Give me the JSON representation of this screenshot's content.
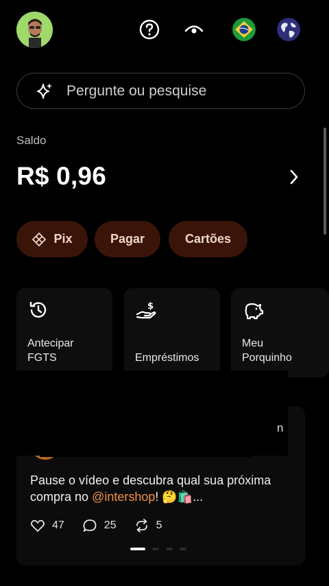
{
  "header": {
    "help_icon": "help-circle-icon",
    "visibility_icon": "eye-icon",
    "country_flag": "brazil-flag-icon",
    "globe_icon": "globe-icon"
  },
  "search": {
    "placeholder": "Pergunte ou pesquise",
    "icon": "sparkle-icon"
  },
  "balance": {
    "label": "Saldo",
    "value": "R$ 0,96"
  },
  "chips": [
    {
      "label": "Pix",
      "icon": "pix-icon"
    },
    {
      "label": "Pagar"
    },
    {
      "label": "Cartões"
    }
  ],
  "shortcuts": [
    {
      "label_line1": "Antecipar",
      "label_line2": "FGTS",
      "icon": "history-clock-icon"
    },
    {
      "label_line1": "",
      "label_line2": "Empréstimos",
      "icon": "hand-money-icon"
    },
    {
      "label_line1": "Meu",
      "label_line2": "Porquinho",
      "icon": "piggy-bank-icon"
    }
  ],
  "feed": {
    "partial_text": "n",
    "text_before": "Pause o vídeo e descubra qual sua próxima compra no ",
    "mention": "@intershop",
    "text_after": "! 🤔🛍️...",
    "likes": "47",
    "comments": "25",
    "reposts": "5"
  },
  "carousel": {
    "active_index": 0,
    "count": 4
  },
  "colors": {
    "background": "#000000",
    "chip_bg": "#3b1409",
    "accent": "#f0924a"
  }
}
